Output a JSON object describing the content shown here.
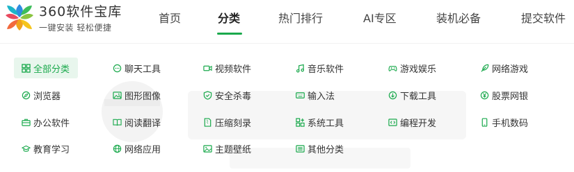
{
  "brand": {
    "title": "360软件宝库",
    "subtitle": "一键安装  轻松便捷"
  },
  "nav": {
    "items": [
      {
        "label": "首页"
      },
      {
        "label": "分类"
      },
      {
        "label": "热门排行"
      },
      {
        "label": "AI专区"
      },
      {
        "label": "装机必备"
      },
      {
        "label": "提交软件"
      }
    ],
    "active": "分类"
  },
  "categories": [
    {
      "label": "全部分类",
      "icon": "grid-icon"
    },
    {
      "label": "聊天工具",
      "icon": "chat-icon"
    },
    {
      "label": "视频软件",
      "icon": "video-icon"
    },
    {
      "label": "音乐软件",
      "icon": "music-icon"
    },
    {
      "label": "游戏娱乐",
      "icon": "gamepad-icon"
    },
    {
      "label": "网络游戏",
      "icon": "feather-icon"
    },
    {
      "label": "浏览器",
      "icon": "compass-icon"
    },
    {
      "label": "图形图像",
      "icon": "image-icon"
    },
    {
      "label": "安全杀毒",
      "icon": "shield-icon"
    },
    {
      "label": "输入法",
      "icon": "keyboard-icon"
    },
    {
      "label": "下载工具",
      "icon": "download-icon"
    },
    {
      "label": "股票网银",
      "icon": "yen-icon"
    },
    {
      "label": "办公软件",
      "icon": "briefcase-icon"
    },
    {
      "label": "阅读翻译",
      "icon": "book-icon"
    },
    {
      "label": "压缩刻录",
      "icon": "file-zip-icon"
    },
    {
      "label": "系统工具",
      "icon": "apps-icon"
    },
    {
      "label": "编程开发",
      "icon": "code-icon"
    },
    {
      "label": "手机数码",
      "icon": "phone-icon"
    },
    {
      "label": "教育学习",
      "icon": "graduation-icon"
    },
    {
      "label": "网络应用",
      "icon": "globe-icon"
    },
    {
      "label": "主题壁纸",
      "icon": "wallpaper-icon"
    },
    {
      "label": "其他分类",
      "icon": "list-icon"
    }
  ],
  "colors": {
    "accent": "#1aa94c",
    "active_bg": "#e8f6ed"
  }
}
